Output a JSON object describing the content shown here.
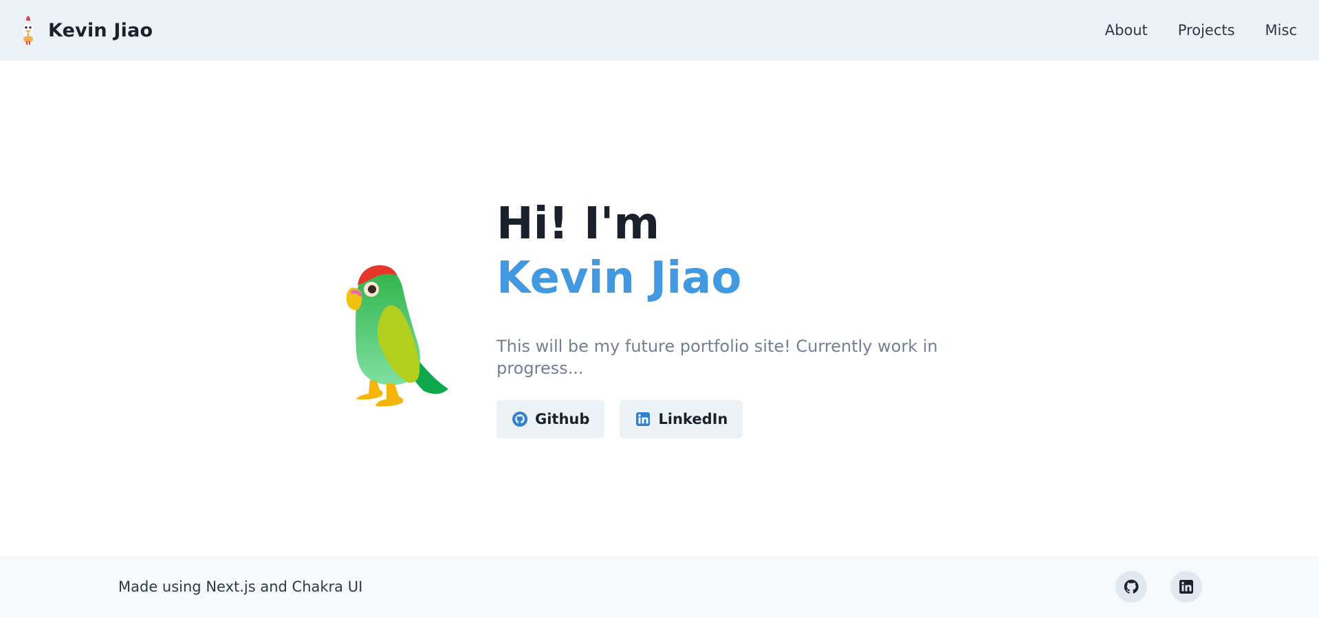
{
  "header": {
    "brand_name": "Kevin Jiao",
    "brand_icon": "chicken-icon",
    "nav": [
      {
        "label": "About"
      },
      {
        "label": "Projects"
      },
      {
        "label": "Misc"
      }
    ]
  },
  "hero": {
    "greeting": "Hi! I'm",
    "name": "Kevin Jiao",
    "tagline": "This will be my future portfolio site! Currently work in progress...",
    "image_icon": "parrot-icon",
    "buttons": [
      {
        "label": "Github",
        "icon": "github-icon"
      },
      {
        "label": "LinkedIn",
        "icon": "linkedin-icon"
      }
    ]
  },
  "footer": {
    "text": "Made using Next.js and Chakra UI",
    "icons": [
      "github-icon",
      "linkedin-icon"
    ]
  },
  "colors": {
    "header_bg": "#edf2f7",
    "accent": "#4299e1",
    "footer_bg": "#f7fafc",
    "muted_text": "#718096"
  }
}
